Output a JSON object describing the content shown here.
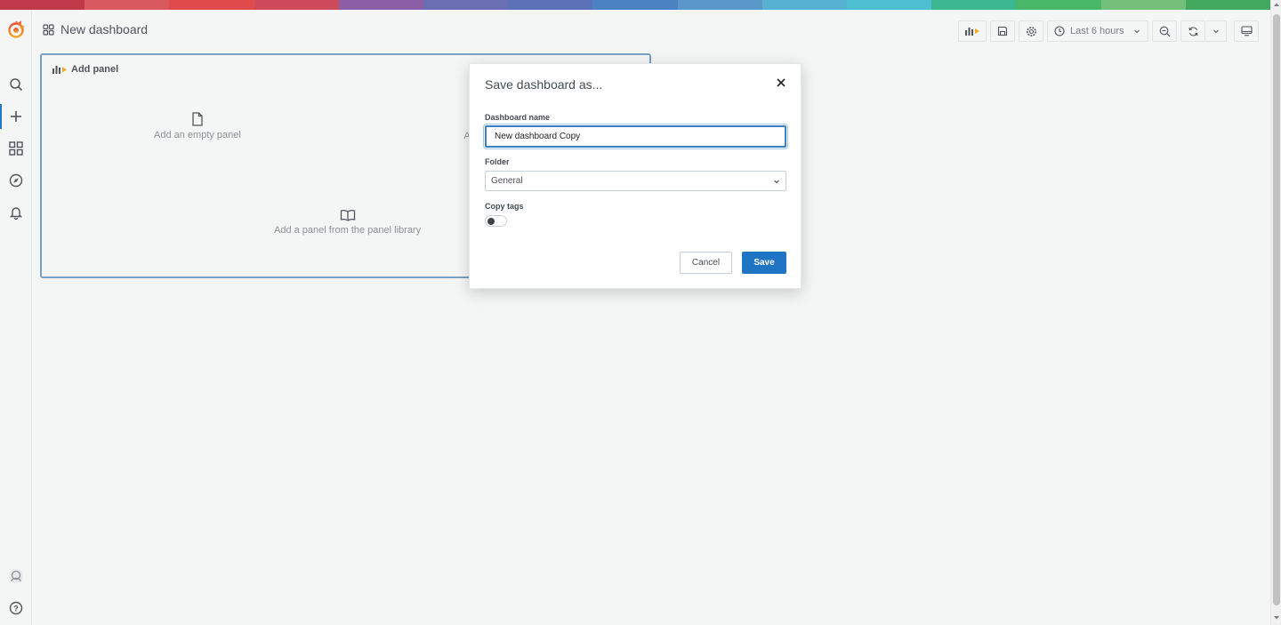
{
  "rainbow_colors": [
    "#c0394b",
    "#d8595f",
    "#e04a4a",
    "#cc4a5a",
    "#8a5fa8",
    "#6a6fb4",
    "#5c72b8",
    "#4a82c4",
    "#5a98cc",
    "#56b0d0",
    "#4cbfd0",
    "#3cb890",
    "#48b868",
    "#74c07a",
    "#42a85e"
  ],
  "nav": {
    "title": "New dashboard",
    "time_range": "Last 6 hours"
  },
  "panel": {
    "header": "Add panel",
    "empty_panel": "Add an empty panel",
    "library_panel": "Add a panel from the panel library",
    "obscured_label_fragment": "A"
  },
  "modal": {
    "title": "Save dashboard as...",
    "name_label": "Dashboard name",
    "name_value": "New dashboard Copy",
    "folder_label": "Folder",
    "folder_value": "General",
    "copy_tags_label": "Copy tags",
    "copy_tags_on": false,
    "cancel_label": "Cancel",
    "save_label": "Save"
  },
  "colors": {
    "accent": "#1f74c4",
    "grafana_orange": "#f5a623"
  }
}
